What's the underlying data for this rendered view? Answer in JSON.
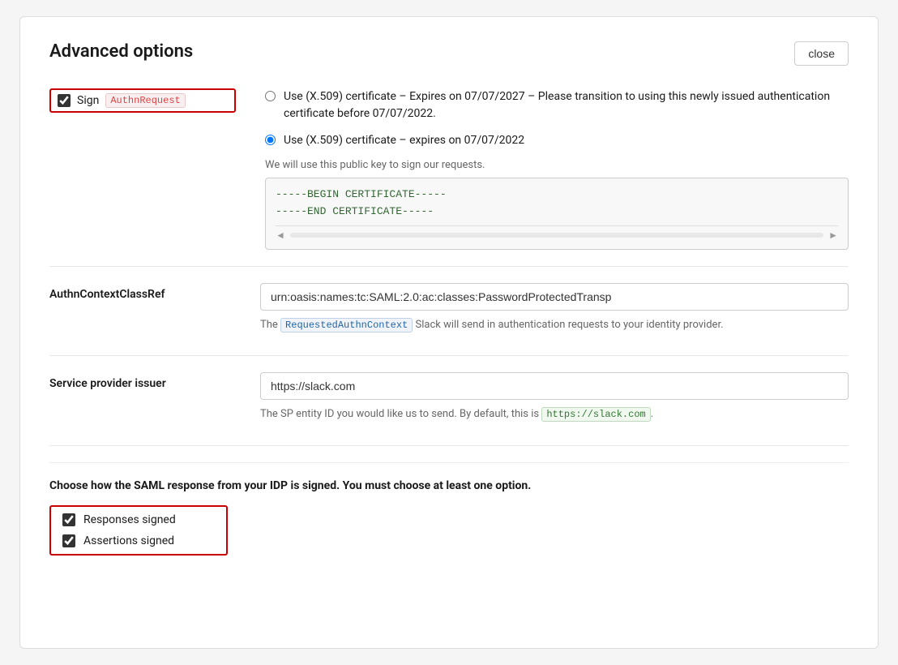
{
  "modal": {
    "title": "Advanced options",
    "close_button": "close"
  },
  "sign_authn": {
    "label": "Sign",
    "tag": "AuthnRequest",
    "checked": true,
    "radio_option_1": {
      "label": "Use (X.509) certificate – Expires on 07/07/2027 – Please transition to using this newly issued authentication certificate before 07/07/2022.",
      "selected": false
    },
    "radio_option_2": {
      "label": "Use (X.509) certificate – expires on 07/07/2022",
      "selected": true
    },
    "public_key_hint": "We will use this public key to sign our requests.",
    "cert_line1": "-----BEGIN CERTIFICATE-----",
    "cert_line2": "-----END CERTIFICATE-----"
  },
  "authn_context": {
    "label": "AuthnContextClassRef",
    "value": "urn:oasis:names:tc:SAML:2.0:ac:classes:PasswordProtectedTransp",
    "help_prefix": "The ",
    "help_tag": "RequestedAuthnContext",
    "help_suffix": " Slack will send in authentication requests to your identity provider."
  },
  "service_provider": {
    "label": "Service provider issuer",
    "value": "https://slack.com",
    "help_prefix": "The SP entity ID you would like us to send. By default, this is ",
    "help_tag": "https://slack.com",
    "help_suffix": "."
  },
  "saml_signing": {
    "title": "Choose how the SAML response from your IDP is signed. You must choose at least one option.",
    "responses_signed_label": "Responses signed",
    "responses_signed_checked": true,
    "assertions_signed_label": "Assertions signed",
    "assertions_signed_checked": true
  },
  "icons": {
    "scroll_left": "◄",
    "scroll_right": "►"
  }
}
